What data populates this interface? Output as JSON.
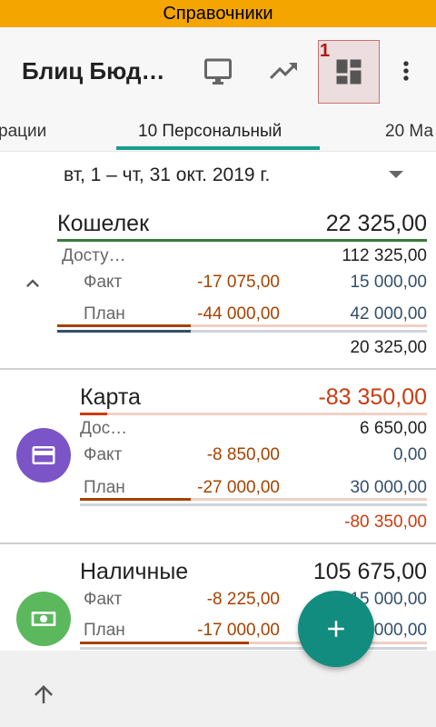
{
  "status_bar": {
    "title": "Справочники"
  },
  "app_bar": {
    "title": "Блиц Бюд…",
    "dashboard_badge": "1",
    "icons": [
      "monitor-icon",
      "trending-up-icon",
      "dashboard-icon",
      "more-vert-icon"
    ]
  },
  "tabs": [
    {
      "label": "рации",
      "active": false
    },
    {
      "label": "10 Персональный",
      "active": true
    },
    {
      "label": "20 Ма",
      "active": false
    }
  ],
  "period": {
    "label": "вт, 1 – чт, 31 окт. 2019 г."
  },
  "accounts": [
    {
      "name": "Кошелек",
      "total": "22 325,00",
      "available_label": "Досту…",
      "available_value": "112 325,00",
      "fact_label": "Факт",
      "fact_expense": "-17 075,00",
      "fact_income": "15 000,00",
      "plan_label": "План",
      "plan_expense": "-44 000,00",
      "plan_income": "42 000,00",
      "balance": "20 325,00",
      "icon": "chevron-up-icon"
    },
    {
      "name": "Карта",
      "total": "-83 350,00",
      "available_label": "Дос…",
      "available_value": "6 650,00",
      "fact_label": "Факт",
      "fact_expense": "-8 850,00",
      "fact_income": "0,00",
      "plan_label": "План",
      "plan_expense": "-27 000,00",
      "plan_income": "30 000,00",
      "balance": "-80 350,00",
      "icon": "credit-card-icon",
      "icon_color": "#7b55c7"
    },
    {
      "name": "Наличные",
      "total": "105 675,00",
      "fact_label": "Факт",
      "fact_expense": "-8 225,00",
      "fact_income": "15 000,00",
      "plan_label": "План",
      "plan_expense": "-17 000,00",
      "plan_income": "15 000,00",
      "icon": "cash-icon",
      "icon_color": "#5cb85c"
    }
  ],
  "colors": {
    "status_bar": "#f5a500",
    "tab_indicator": "#1a9c8c",
    "fab": "#128c7e",
    "expense": "#a64200",
    "income": "#334f6b",
    "negative_total": "#cc3a10"
  },
  "fab_icon": "plus-icon",
  "bottom_icon": "arrow-up-icon"
}
